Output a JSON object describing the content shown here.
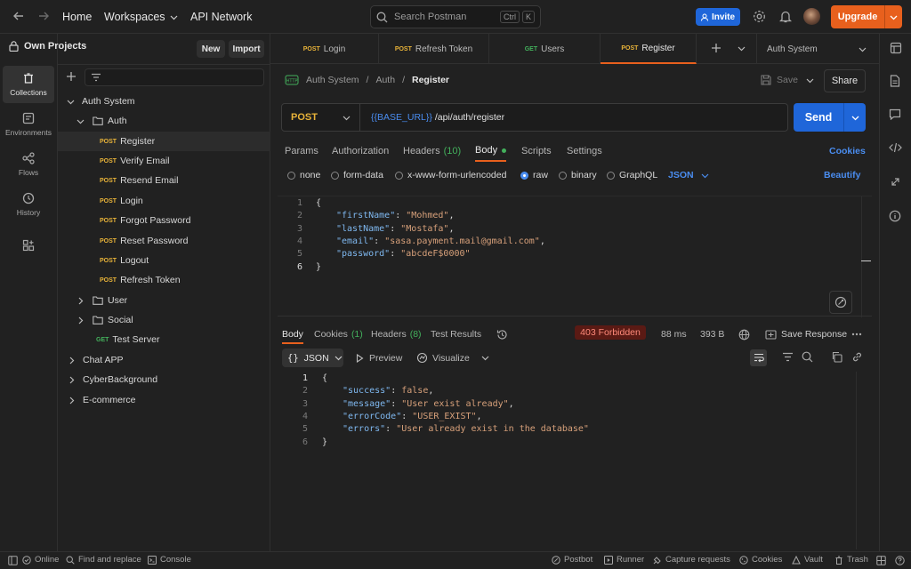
{
  "topbar": {
    "home": "Home",
    "workspaces": "Workspaces",
    "api_network": "API Network",
    "search_placeholder": "Search Postman",
    "kbd_ctrl": "Ctrl",
    "kbd_k": "K",
    "invite": "Invite",
    "upgrade": "Upgrade"
  },
  "rail": {
    "collections": "Collections",
    "environments": "Environments",
    "flows": "Flows",
    "history": "History"
  },
  "sidebar": {
    "workspace": "Own Projects",
    "new": "New",
    "import": "Import",
    "tree": {
      "auth_system": "Auth System",
      "auth": "Auth",
      "requests": [
        {
          "method": "POST",
          "label": "Register"
        },
        {
          "method": "POST",
          "label": "Verify Email"
        },
        {
          "method": "POST",
          "label": "Resend Email"
        },
        {
          "method": "POST",
          "label": "Login"
        },
        {
          "method": "POST",
          "label": "Forgot Password"
        },
        {
          "method": "POST",
          "label": "Reset Password"
        },
        {
          "method": "POST",
          "label": "Logout"
        },
        {
          "method": "POST",
          "label": "Refresh Token"
        }
      ],
      "user": "User",
      "social": "Social",
      "test_server_method": "GET",
      "test_server": "Test Server",
      "chat_app": "Chat APP",
      "cyber": "CyberBackground",
      "ecommerce": "E-commerce"
    }
  },
  "tabs": [
    {
      "method": "POST",
      "label": "Login"
    },
    {
      "method": "POST",
      "label": "Refresh Token"
    },
    {
      "method": "GET",
      "label": "Users"
    },
    {
      "method": "POST",
      "label": "Register"
    }
  ],
  "env": "Auth System",
  "request": {
    "breadcrumb": [
      "Auth System",
      "Auth",
      "Register"
    ],
    "save": "Save",
    "share": "Share",
    "method": "POST",
    "url_var": "{{BASE_URL}}",
    "url_path": "/api/auth/register",
    "send": "Send",
    "tabs": {
      "params": "Params",
      "authorization": "Authorization",
      "headers": "Headers",
      "headers_count": "(10)",
      "body": "Body",
      "scripts": "Scripts",
      "settings": "Settings",
      "cookies": "Cookies"
    },
    "body_types": {
      "none": "none",
      "form_data": "form-data",
      "urlencoded": "x-www-form-urlencoded",
      "raw": "raw",
      "binary": "binary",
      "graphql": "GraphQL",
      "json": "JSON",
      "beautify": "Beautify"
    },
    "body_lines": [
      "{",
      "\"firstName\": \"Mohmed\",",
      "\"lastName\": \"Mostafa\",",
      "\"email\": \"sasa.payment.mail@gmail.com\",",
      "\"password\": \"abcdeF$0000\"",
      "}"
    ],
    "body_kv": [
      {
        "k": "\"firstName\"",
        "v": "\"Mohmed\""
      },
      {
        "k": "\"lastName\"",
        "v": "\"Mostafa\""
      },
      {
        "k": "\"email\"",
        "v": "\"sasa.payment.mail@gmail.com\""
      },
      {
        "k": "\"password\"",
        "v": "\"abcdeF$0000\""
      }
    ]
  },
  "response": {
    "tabs": {
      "body": "Body",
      "cookies": "Cookies",
      "cookies_count": "(1)",
      "headers": "Headers",
      "headers_count": "(8)",
      "test_results": "Test Results"
    },
    "status": "403 Forbidden",
    "time": "88 ms",
    "size": "393 B",
    "save_response": "Save Response",
    "format": "JSON",
    "preview": "Preview",
    "visualize": "Visualize",
    "kv": [
      {
        "k": "\"success\"",
        "v": "false"
      },
      {
        "k": "\"message\"",
        "v": "\"User exist already\""
      },
      {
        "k": "\"errorCode\"",
        "v": "\"USER_EXIST\""
      },
      {
        "k": "\"errors\"",
        "v": "\"User already exist in the database\""
      }
    ]
  },
  "footer": {
    "online": "Online",
    "find": "Find and replace",
    "console": "Console",
    "postbot": "Postbot",
    "runner": "Runner",
    "capture": "Capture requests",
    "cookies": "Cookies",
    "vault": "Vault",
    "trash": "Trash"
  },
  "colors": {
    "accent": "#e8601d",
    "blue": "#1f66d9",
    "post": "#e8b339",
    "get": "#43b05c"
  }
}
